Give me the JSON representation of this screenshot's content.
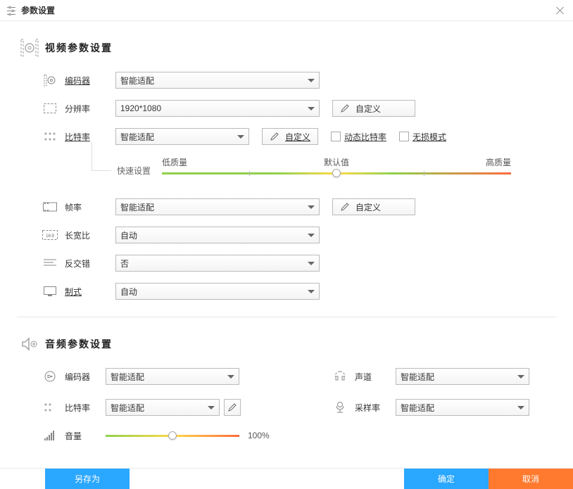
{
  "title": "参数设置",
  "video": {
    "section_title": "视频参数设置",
    "encoder_label": "编码器",
    "encoder_value": "智能适配",
    "resolution_label": "分辨率",
    "resolution_value": "1920*1080",
    "resolution_custom_label": "自定义",
    "bitrate_label": "比特率",
    "bitrate_value": "智能适配",
    "bitrate_custom_label": "自定义",
    "dynamic_bitrate_label": "动态比特率",
    "lossless_label": "无损模式",
    "quick_set_label": "快速设置",
    "quality_low": "低质量",
    "quality_default": "默认值",
    "quality_high": "高质量",
    "fps_label": "帧率",
    "fps_value": "智能适配",
    "fps_custom_label": "自定义",
    "aspect_label": "长宽比",
    "aspect_value": "自动",
    "deinterlace_label": "反交错",
    "deinterlace_value": "否",
    "standard_label": "制式",
    "standard_value": "自动"
  },
  "audio": {
    "section_title": "音频参数设置",
    "encoder_label": "编码器",
    "encoder_value": "智能适配",
    "channel_label": "声道",
    "channel_value": "智能适配",
    "bitrate_label": "比特率",
    "bitrate_value": "智能适配",
    "samplerate_label": "采样率",
    "samplerate_value": "智能适配",
    "volume_label": "音量",
    "volume_value": "100%"
  },
  "footer": {
    "saveas": "另存为",
    "ok": "确定",
    "cancel": "取消"
  }
}
